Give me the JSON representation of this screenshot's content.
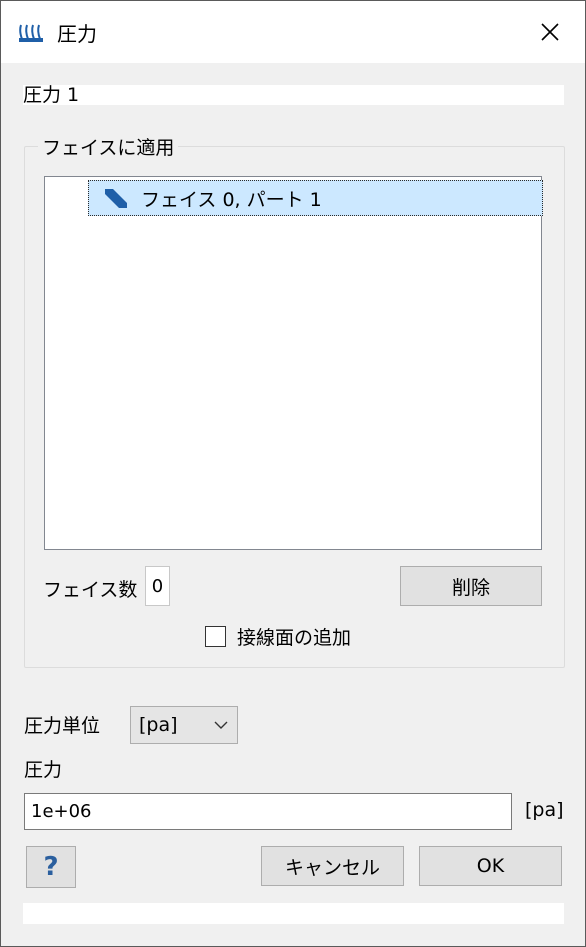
{
  "window": {
    "title": "圧力"
  },
  "name_field": {
    "value": "圧力 1"
  },
  "face_group": {
    "label": "フェイスに適用",
    "items": [
      {
        "label": "フェイス 0, パート 1"
      }
    ],
    "count_label": "フェイス数",
    "count_value": "0",
    "delete_label": "削除",
    "tangent_label": "接線面の追加"
  },
  "units": {
    "label": "圧力単位",
    "selected": "[pa]"
  },
  "pressure": {
    "label": "圧力",
    "value": "1e+06",
    "unit": "[pa]"
  },
  "buttons": {
    "help": "?",
    "cancel": "キャンセル",
    "ok": "OK"
  },
  "colors": {
    "selection": "#cce8ff",
    "accent": "#1f5fa8"
  }
}
